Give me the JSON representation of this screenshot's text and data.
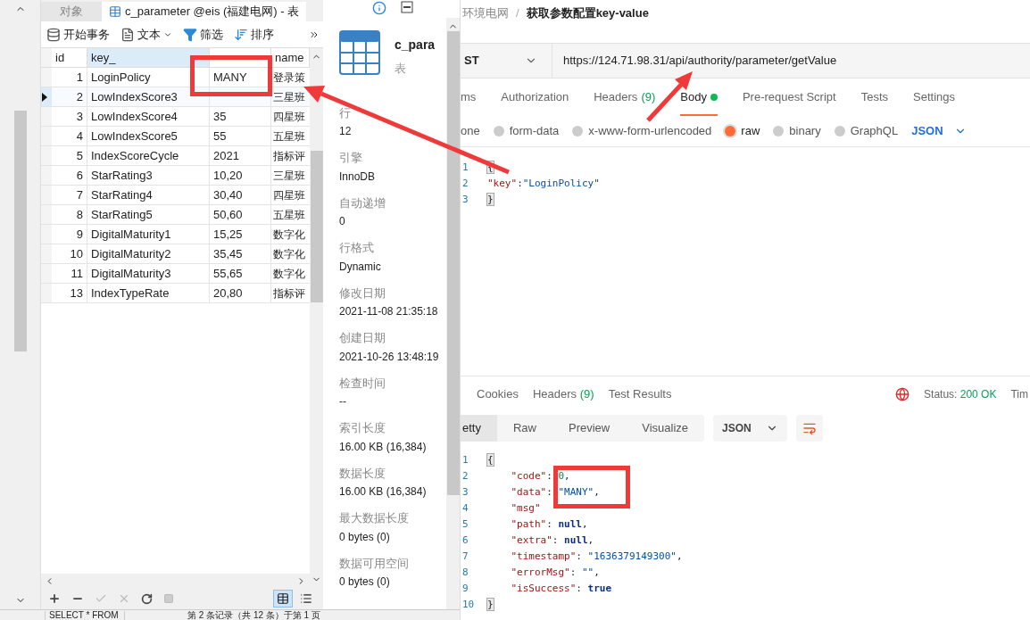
{
  "navicat": {
    "tabs": [
      {
        "label": "对象",
        "selected": false
      },
      {
        "label": "c_parameter @eis (福建电网) - 表",
        "selected": true
      }
    ],
    "toolbar": [
      {
        "kind": "transaction",
        "label": "开始事务"
      },
      {
        "kind": "text",
        "label": "文本"
      },
      {
        "kind": "filter",
        "label": "筛选"
      },
      {
        "kind": "sort",
        "label": "排序"
      }
    ],
    "table": {
      "columns": [
        "id",
        "key_",
        "",
        "name"
      ],
      "rows": [
        {
          "id": "1",
          "key": "LoginPolicy",
          "value": "MANY",
          "name": "登录策",
          "selected": false
        },
        {
          "id": "2",
          "key": "LowIndexScore3",
          "value": "",
          "name": "三星班",
          "selected": true
        },
        {
          "id": "3",
          "key": "LowIndexScore4",
          "value": "35",
          "name": "四星班",
          "selected": false
        },
        {
          "id": "4",
          "key": "LowIndexScore5",
          "value": "55",
          "name": "五星班",
          "selected": false
        },
        {
          "id": "5",
          "key": "IndexScoreCycle",
          "value": "2021",
          "name": "指标评",
          "selected": false
        },
        {
          "id": "6",
          "key": "StarRating3",
          "value": "10,20",
          "name": "三星班",
          "selected": false
        },
        {
          "id": "7",
          "key": "StarRating4",
          "value": "30,40",
          "name": "四星班",
          "selected": false
        },
        {
          "id": "8",
          "key": "StarRating5",
          "value": "50,60",
          "name": "五星班",
          "selected": false
        },
        {
          "id": "9",
          "key": "DigitalMaturity1",
          "value": "15,25",
          "name": "数字化",
          "selected": false
        },
        {
          "id": "10",
          "key": "DigitalMaturity2",
          "value": "35,45",
          "name": "数字化",
          "selected": false
        },
        {
          "id": "11",
          "key": "DigitalMaturity3",
          "value": "55,65",
          "name": "数字化",
          "selected": false
        },
        {
          "id": "13",
          "key": "IndexTypeRate",
          "value": "20,80",
          "name": "指标评",
          "selected": false
        }
      ]
    },
    "views": [
      {
        "kind": "grid",
        "selected": true
      },
      {
        "kind": "form",
        "selected": false
      }
    ],
    "status_bar": {
      "query": "SELECT * FROM",
      "record": "第 2 条记录（共 12 条）于第 1 页"
    }
  },
  "info_panel": {
    "table_name": "c_para",
    "table_type": "表",
    "properties": [
      {
        "label": "行",
        "value": "12"
      },
      {
        "label": "引擎",
        "value": "InnoDB"
      },
      {
        "label": "自动递增",
        "value": "0"
      },
      {
        "label": "行格式",
        "value": "Dynamic"
      },
      {
        "label": "修改日期",
        "value": "2021-11-08 21:35:18"
      },
      {
        "label": "创建日期",
        "value": "2021-10-26 13:48:19"
      },
      {
        "label": "检查时间",
        "value": "--"
      },
      {
        "label": "索引长度",
        "value": "16.00 KB (16,384)"
      },
      {
        "label": "数据长度",
        "value": "16.00 KB (16,384)"
      },
      {
        "label": "最大数据长度",
        "value": "0 bytes (0)"
      },
      {
        "label": "数据可用空间",
        "value": "0 bytes (0)"
      }
    ]
  },
  "postman": {
    "breadcrumb": {
      "parent": "环境电网",
      "separator": "/",
      "title": "获取参数配置key-value"
    },
    "method": "ST",
    "url": "https://124.71.98.31/api/authority/parameter/getValue",
    "request_tabs": [
      {
        "label": "ms",
        "selected": false
      },
      {
        "label": "Authorization",
        "selected": false
      },
      {
        "label": "Headers",
        "count": "(9)",
        "selected": false
      },
      {
        "label": "Body",
        "selected": true,
        "dot": true
      },
      {
        "label": "Pre-request Script",
        "selected": false
      },
      {
        "label": "Tests",
        "selected": false
      },
      {
        "label": "Settings",
        "selected": false
      }
    ],
    "body_types": [
      {
        "label": "one",
        "selected": false,
        "radio": false
      },
      {
        "label": "form-data",
        "selected": false,
        "radio": true
      },
      {
        "label": "x-www-form-urlencoded",
        "selected": false,
        "radio": true
      },
      {
        "label": "raw",
        "selected": true,
        "radio": true
      },
      {
        "label": "binary",
        "selected": false,
        "radio": true
      },
      {
        "label": "GraphQL",
        "selected": false,
        "radio": true
      }
    ],
    "body_format": "JSON",
    "request_lines": [
      {
        "num": "1",
        "tokens": [
          {
            "kind": "bracket",
            "text": "{"
          }
        ]
      },
      {
        "num": "2",
        "tokens": [
          {
            "kind": "key",
            "text": "\"key\""
          },
          {
            "kind": "punct",
            "text": ":"
          },
          {
            "kind": "string",
            "text": "\"LoginPolicy\""
          }
        ]
      },
      {
        "num": "3",
        "tokens": [
          {
            "kind": "bracket",
            "text": "}"
          }
        ]
      }
    ],
    "response_tabs": [
      {
        "label": "Cookies"
      },
      {
        "label": "Headers",
        "count": "(9)"
      },
      {
        "label": "Test Results"
      }
    ],
    "status": {
      "label": "Status:",
      "value": "200 OK",
      "time": "Tim"
    },
    "view_tabs": [
      {
        "label": "etty",
        "selected": true
      },
      {
        "label": "Raw",
        "selected": false
      },
      {
        "label": "Preview",
        "selected": false
      },
      {
        "label": "Visualize",
        "selected": false
      }
    ],
    "response_format": "JSON",
    "response_lines": [
      {
        "num": "1",
        "tokens": [
          {
            "kind": "bracket",
            "text": "{"
          }
        ]
      },
      {
        "num": "2",
        "tokens": [
          {
            "kind": "key",
            "text": "    \"code\""
          },
          {
            "kind": "punct",
            "text": ": "
          },
          {
            "kind": "number",
            "text": "0"
          },
          {
            "kind": "punct",
            "text": ","
          }
        ]
      },
      {
        "num": "3",
        "tokens": [
          {
            "kind": "key",
            "text": "    \"data\""
          },
          {
            "kind": "punct",
            "text": ": "
          },
          {
            "kind": "string",
            "text": "\"MANY\""
          },
          {
            "kind": "punct",
            "text": ","
          }
        ]
      },
      {
        "num": "4",
        "tokens": [
          {
            "kind": "key",
            "text": "    \"msg\""
          }
        ]
      },
      {
        "num": "5",
        "tokens": [
          {
            "kind": "key",
            "text": "    \"path\""
          },
          {
            "kind": "punct",
            "text": ": "
          },
          {
            "kind": "literal",
            "text": "null"
          },
          {
            "kind": "punct",
            "text": ","
          }
        ]
      },
      {
        "num": "6",
        "tokens": [
          {
            "kind": "key",
            "text": "    \"extra\""
          },
          {
            "kind": "punct",
            "text": ": "
          },
          {
            "kind": "literal",
            "text": "null"
          },
          {
            "kind": "punct",
            "text": ","
          }
        ]
      },
      {
        "num": "7",
        "tokens": [
          {
            "kind": "key",
            "text": "    \"timestamp\""
          },
          {
            "kind": "punct",
            "text": ": "
          },
          {
            "kind": "string",
            "text": "\"1636379149300\""
          },
          {
            "kind": "punct",
            "text": ","
          }
        ]
      },
      {
        "num": "8",
        "tokens": [
          {
            "kind": "key",
            "text": "    \"errorMsg\""
          },
          {
            "kind": "punct",
            "text": ": "
          },
          {
            "kind": "string",
            "text": "\"\""
          },
          {
            "kind": "punct",
            "text": ","
          }
        ]
      },
      {
        "num": "9",
        "tokens": [
          {
            "kind": "key",
            "text": "    \"isSuccess\""
          },
          {
            "kind": "punct",
            "text": ": "
          },
          {
            "kind": "literal",
            "text": "true"
          }
        ]
      },
      {
        "num": "10",
        "tokens": [
          {
            "kind": "bracket",
            "text": "}"
          }
        ]
      }
    ]
  }
}
